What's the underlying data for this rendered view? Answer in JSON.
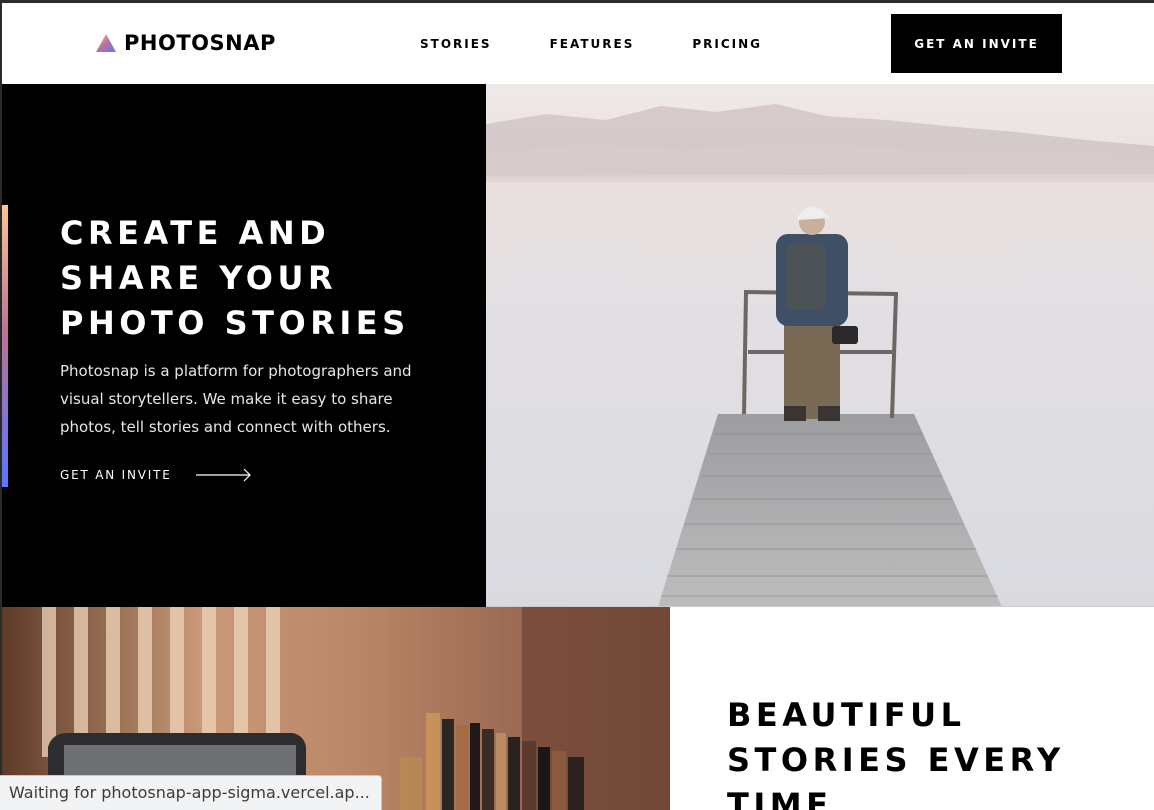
{
  "header": {
    "logo_text": "PHOTOSNAP",
    "nav": [
      "STORIES",
      "FEATURES",
      "PRICING"
    ],
    "cta_label": "GET AN INVITE"
  },
  "hero": {
    "title": "CREATE AND SHARE YOUR PHOTO STORIES",
    "description": "Photosnap is a platform for photographers and visual storytellers. We make it easy to share photos, tell stories and connect with others.",
    "link_label": "GET AN INVITE"
  },
  "stories_section": {
    "title": "BEAUTIFUL STORIES EVERY TIME"
  },
  "status_bar": {
    "text": "Waiting for photosnap-app-sigma.vercel.ap..."
  },
  "colors": {
    "black": "#000000",
    "white": "#ffffff",
    "accent_gradient": [
      "#ffc593",
      "#bc7198",
      "#5a77ff"
    ]
  },
  "icons": [
    "logo-triangle-icon",
    "arrow-right-icon"
  ]
}
